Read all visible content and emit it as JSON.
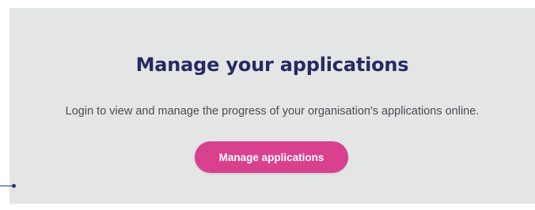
{
  "panel": {
    "title": "Manage your applications",
    "description": "Login to view and manage the progress of your organisation's applications online.",
    "button_label": "Manage applications"
  },
  "colors": {
    "panel_background": "#e4e6e5",
    "title": "#262a63",
    "button": "#d9418f",
    "button_text": "#ffffff",
    "pointer": "#2a3a7a"
  }
}
